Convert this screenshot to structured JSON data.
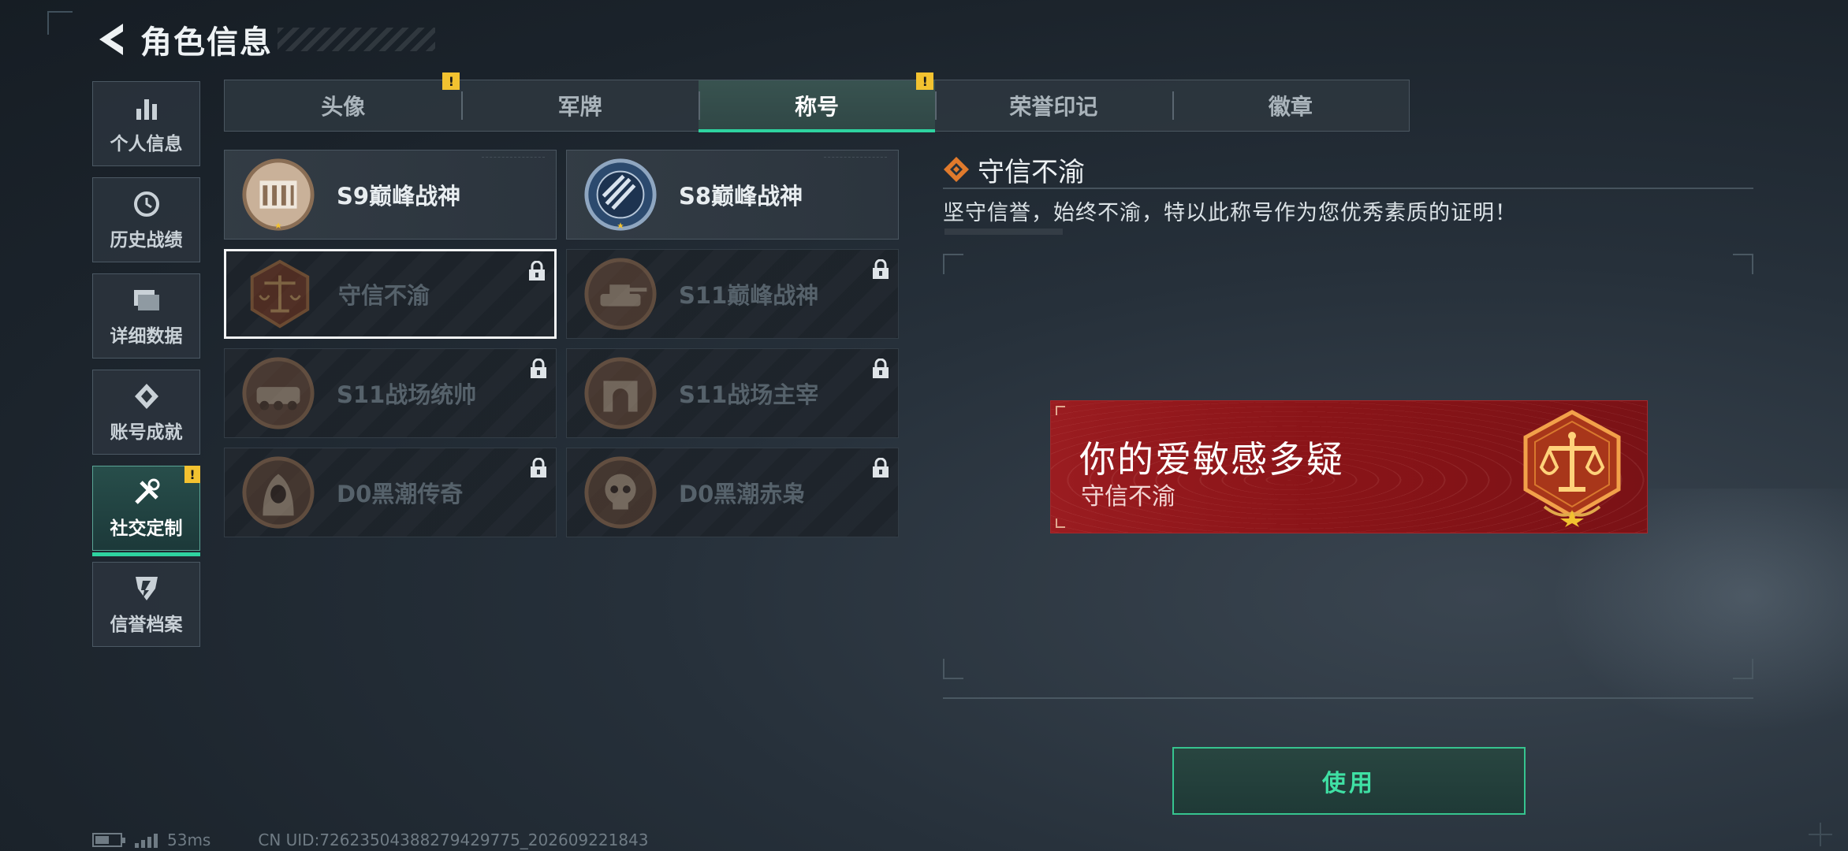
{
  "header": {
    "title": "角色信息"
  },
  "sidebar": {
    "items": [
      {
        "label": "个人信息",
        "icon": "bar-chart-icon",
        "active": false
      },
      {
        "label": "历史战绩",
        "icon": "history-clock-icon",
        "active": false
      },
      {
        "label": "详细数据",
        "icon": "folder-icon",
        "active": false
      },
      {
        "label": "账号成就",
        "icon": "medal-icon",
        "active": false
      },
      {
        "label": "社交定制",
        "icon": "tools-icon",
        "active": true,
        "warning": "!"
      },
      {
        "label": "信誉档案",
        "icon": "shield-icon",
        "active": false
      }
    ]
  },
  "tabs": [
    {
      "label": "头像",
      "active": false,
      "warning": "!"
    },
    {
      "label": "军牌",
      "active": false
    },
    {
      "label": "称号",
      "active": true,
      "warning": "!"
    },
    {
      "label": "荣誉印记",
      "active": false
    },
    {
      "label": "徽章",
      "active": false
    }
  ],
  "titles": [
    {
      "name": "S9巅峰战神",
      "locked": false,
      "badge": "fortress-badge-icon"
    },
    {
      "name": "S8巅峰战神",
      "locked": false,
      "badge": "blue-emblem-badge-icon"
    },
    {
      "name": "守信不渝",
      "locked": true,
      "selected": true,
      "badge": "scales-badge-icon"
    },
    {
      "name": "S11巅峰战神",
      "locked": true,
      "badge": "tank-badge-icon"
    },
    {
      "name": "S11战场统帅",
      "locked": true,
      "badge": "vehicle-badge-icon"
    },
    {
      "name": "S11战场主宰",
      "locked": true,
      "badge": "arch-badge-icon"
    },
    {
      "name": "D0黑潮传奇",
      "locked": true,
      "badge": "hooded-figure-badge-icon"
    },
    {
      "name": "D0黑潮赤枭",
      "locked": true,
      "badge": "skull-badge-icon"
    }
  ],
  "detail": {
    "title": "守信不渝",
    "description": "坚守信誉，始终不渝，特以此称号作为您优秀素质的证明！"
  },
  "banner": {
    "nickname": "你的爱敏感多疑",
    "title": "守信不渝"
  },
  "actions": {
    "use_label": "使用"
  },
  "footer": {
    "ping": "53ms",
    "uid": "CN UID:7262350438827942977​5_202609221843",
    "battery_level": 0.55
  },
  "colors": {
    "accent": "#2ed3a0",
    "warning": "#f2c230",
    "banner_red": "#9a1c20"
  }
}
